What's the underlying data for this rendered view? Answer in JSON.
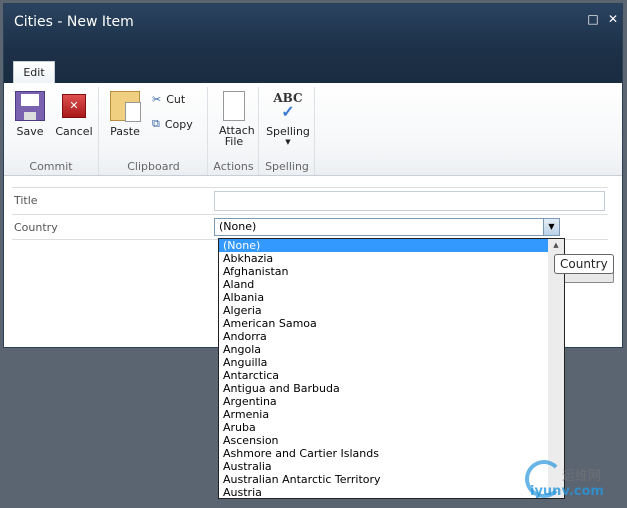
{
  "window": {
    "title": "Cities - New Item"
  },
  "ribbon": {
    "tab": "Edit",
    "groups": [
      {
        "label": "Commit",
        "buttons": [
          "Save",
          "Cancel"
        ]
      },
      {
        "label": "Clipboard",
        "buttons": [
          "Paste",
          "Cut",
          "Copy"
        ]
      },
      {
        "label": "Actions",
        "buttons": [
          "Attach File"
        ]
      },
      {
        "label": "Spelling",
        "buttons": [
          "Spelling"
        ]
      }
    ]
  },
  "form": {
    "title_label": "Title",
    "title_value": "",
    "country_label": "Country",
    "country_value": "(None)"
  },
  "dropdown": {
    "options": [
      "(None)",
      "Abkhazia",
      "Afghanistan",
      "Aland",
      "Albania",
      "Algeria",
      "American Samoa",
      "Andorra",
      "Angola",
      "Anguilla",
      "Antarctica",
      "Antigua and Barbuda",
      "Argentina",
      "Armenia",
      "Aruba",
      "Ascension",
      "Ashmore and Cartier Islands",
      "Australia",
      "Australian Antarctic Territory",
      "Austria"
    ],
    "selected": "(None)"
  },
  "tooltip": "Country",
  "watermark": {
    "cn": "运维网",
    "en": "iyunv.com"
  },
  "colors": {
    "titlebar": "#1c3047",
    "selection": "#3399ff",
    "background": "#5b6572"
  }
}
